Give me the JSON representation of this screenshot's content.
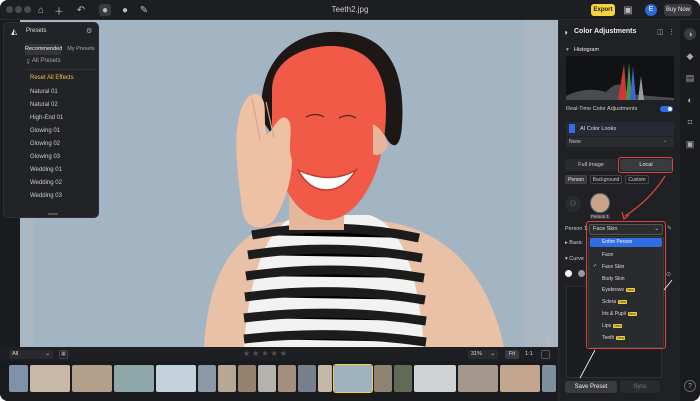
{
  "titlebar": {
    "document_title": "Teeth2.jpg",
    "export_label": "Export",
    "avatar_letter": "E",
    "buy_label": "Buy Now"
  },
  "presets": {
    "title": "Presets",
    "tab_recommended": "Recommended",
    "tab_my": "My Presets",
    "all_label": "All Presets",
    "items": [
      "Reset All Effects",
      "Natural 01",
      "Natural 02",
      "High-End 01",
      "Glowing 01",
      "Glowing 02",
      "Glowing 03",
      "Wedding 01",
      "Wedding 02",
      "Wedding 03"
    ]
  },
  "filmstrip": {
    "filter_label": "All",
    "zoom_label": "31%",
    "fit_label": "Fit",
    "one_to_one_label": "1:1",
    "rating_stars": "★★★★★"
  },
  "color_panel": {
    "title": "Color Adjustments",
    "histogram_label": "Histogram",
    "realtime_label": "Real-Time Color Adjustments",
    "ai_color_looks": "AI Color Looks",
    "none_label": "None",
    "full_image_label": "Full Image",
    "local_label": "Local",
    "chips": [
      "Person",
      "Background",
      "Custom"
    ],
    "person_tag": "Person 1",
    "person_row_label": "Person 1:",
    "selected_area": "Face Skin",
    "basic_label": "Basic",
    "curves_label": "Curve",
    "menu_items": [
      {
        "label": "Entire Person",
        "pro": false,
        "highlighted": true,
        "checked": false
      },
      {
        "label": "Face",
        "pro": false,
        "highlighted": false,
        "checked": false
      },
      {
        "label": "Face Skin",
        "pro": false,
        "highlighted": false,
        "checked": true
      },
      {
        "label": "Body Skin",
        "pro": false,
        "highlighted": false,
        "checked": false
      },
      {
        "label": "Eyebrows",
        "pro": true,
        "highlighted": false,
        "checked": false
      },
      {
        "label": "Sclera",
        "pro": true,
        "highlighted": false,
        "checked": false
      },
      {
        "label": "Iris & Pupil",
        "pro": true,
        "highlighted": false,
        "checked": false
      },
      {
        "label": "Lips",
        "pro": true,
        "highlighted": false,
        "checked": false
      },
      {
        "label": "Teeth",
        "pro": true,
        "highlighted": false,
        "checked": false
      }
    ],
    "pro_badge": "New",
    "save_preset": "Save Preset",
    "sync_label": "Sync"
  },
  "colors": {
    "accent_yellow": "#f5d33c",
    "highlight_blue": "#2f6fe4",
    "annotation_red": "#e0443a",
    "face_mask": "#f05a46"
  }
}
